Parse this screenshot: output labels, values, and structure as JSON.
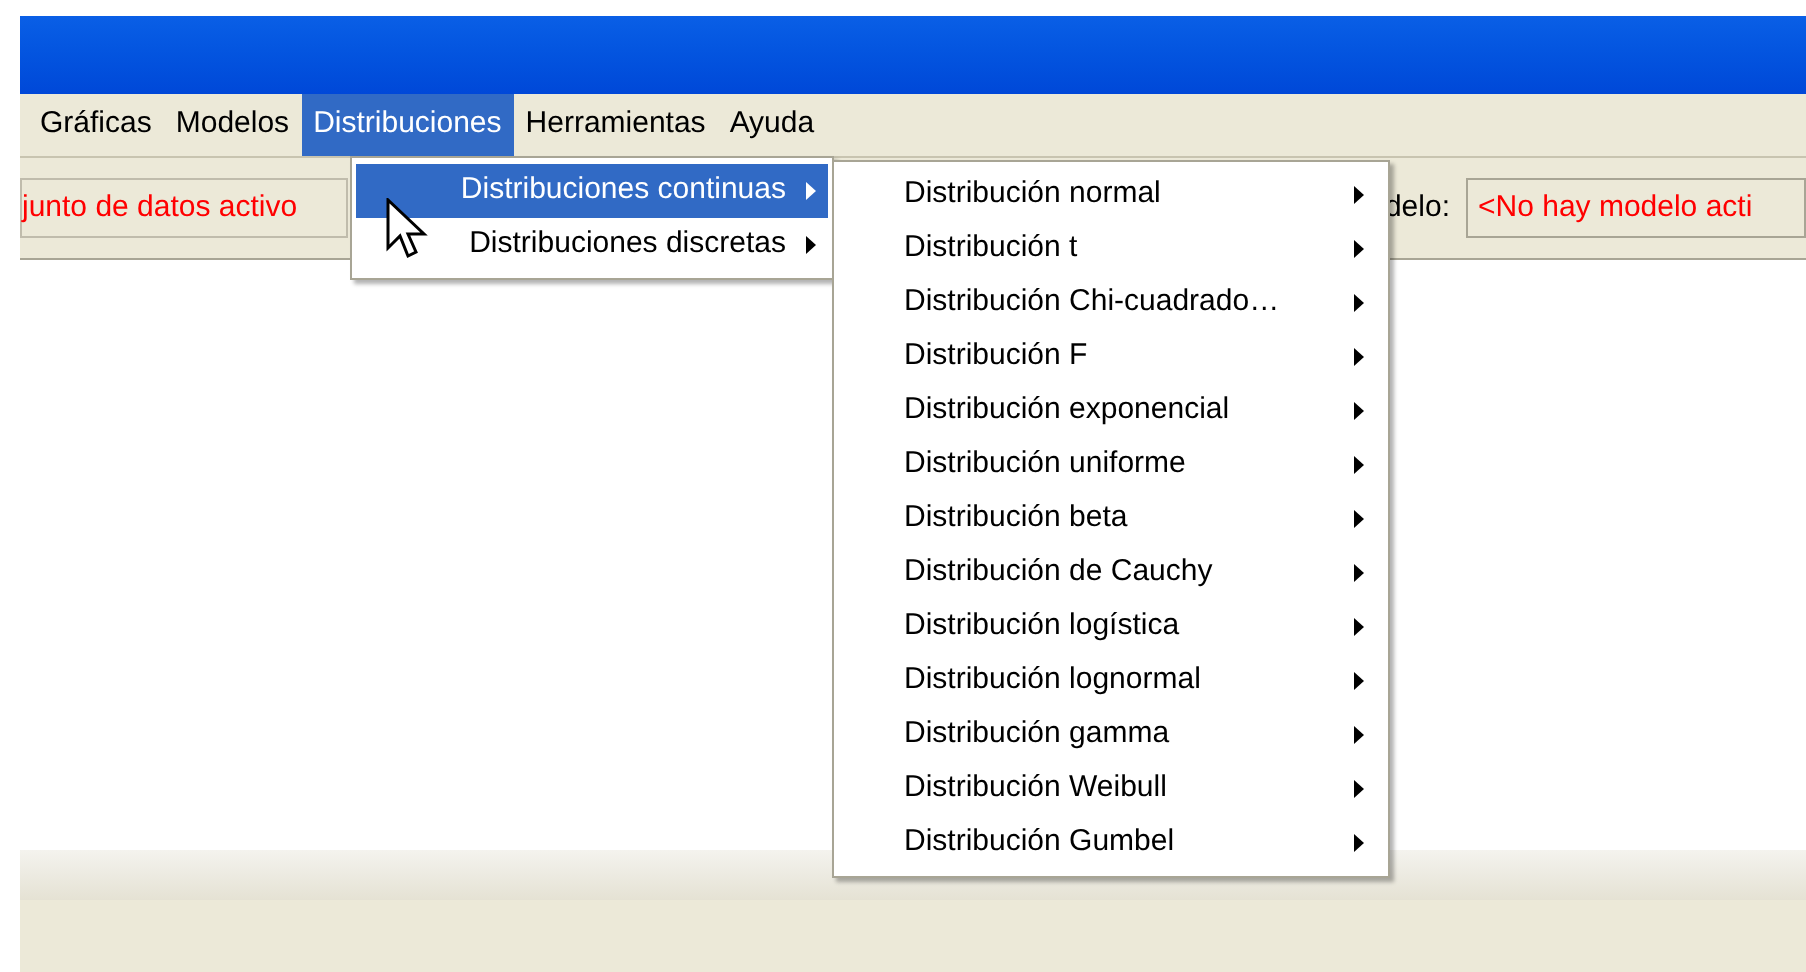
{
  "menu_bar": [
    {
      "label": "Gráficas",
      "selected": false
    },
    {
      "label": "Modelos",
      "selected": false
    },
    {
      "label": "Distribuciones",
      "selected": true
    },
    {
      "label": "Herramientas",
      "selected": false
    },
    {
      "label": "Ayuda",
      "selected": false
    }
  ],
  "toolbar": {
    "dataset_value": "junto de datos activo",
    "model_label": "delo:",
    "model_value": "<No hay modelo acti"
  },
  "dropdown": [
    {
      "label": "Distribuciones continuas",
      "selected": true
    },
    {
      "label": "Distribuciones discretas",
      "selected": false
    }
  ],
  "submenu": [
    {
      "label": "Distribución normal"
    },
    {
      "label": "Distribución t"
    },
    {
      "label": "Distribución Chi-cuadrado…"
    },
    {
      "label": "Distribución F"
    },
    {
      "label": "Distribución exponencial"
    },
    {
      "label": "Distribución uniforme"
    },
    {
      "label": "Distribución beta"
    },
    {
      "label": "Distribución de Cauchy"
    },
    {
      "label": "Distribución logística"
    },
    {
      "label": "Distribución lognormal"
    },
    {
      "label": "Distribución gamma"
    },
    {
      "label": "Distribución Weibull"
    },
    {
      "label": "Distribución Gumbel"
    }
  ]
}
